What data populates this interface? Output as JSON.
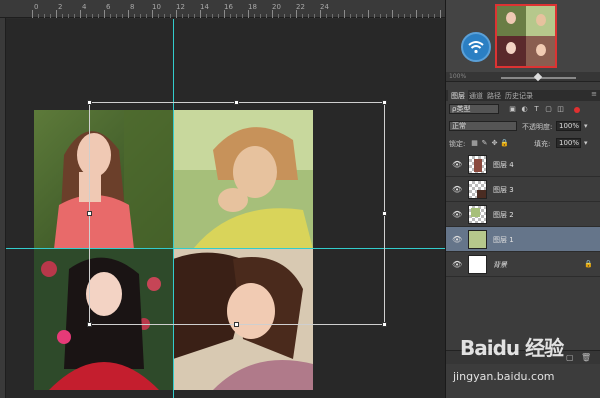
{
  "ruler": {
    "labels": [
      "0",
      "2",
      "4",
      "6",
      "8",
      "10",
      "12",
      "14",
      "16",
      "18",
      "20",
      "22",
      "24"
    ]
  },
  "navigator": {
    "zoom": "100%"
  },
  "panel_tabs": {
    "items": [
      "图层",
      "通道",
      "路径",
      "历史记录"
    ],
    "active": "图层"
  },
  "layers_panel": {
    "filter_label": "ρ类型",
    "blend_mode": "正常",
    "opacity_label": "不透明度:",
    "opacity_value": "100%",
    "lock_label": "锁定:",
    "fill_label": "填充:",
    "fill_value": "100%",
    "layers": [
      {
        "name": "图层 4",
        "selected": false
      },
      {
        "name": "图层 3",
        "selected": false
      },
      {
        "name": "图层 2",
        "selected": false
      },
      {
        "name": "图层 1",
        "selected": true
      },
      {
        "name": "背景",
        "selected": false,
        "locked": true
      }
    ]
  },
  "watermark": {
    "logo_text": "Baidu 经验",
    "url": "jingyan.baidu.com"
  },
  "colors": {
    "guide": "#33cccc",
    "selected_layer": "#65758a",
    "nav_border": "#dd3333"
  }
}
